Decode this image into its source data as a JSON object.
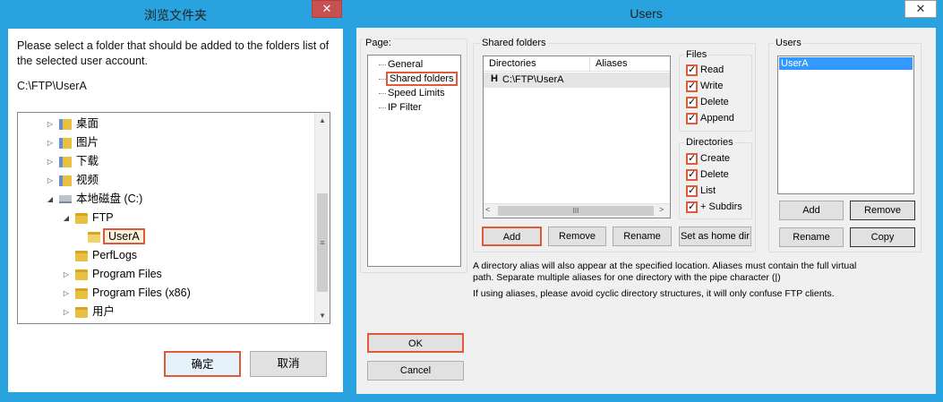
{
  "browse": {
    "title": "浏览文件夹",
    "close": "✕",
    "description": "Please select a folder that should be added to the folders list of the selected user account.",
    "path": "C:\\FTP\\UserA",
    "tree": [
      {
        "label": "桌面",
        "expander": "▷"
      },
      {
        "label": "图片",
        "expander": "▷"
      },
      {
        "label": "下载",
        "expander": "▷"
      },
      {
        "label": "视频",
        "expander": "▷"
      },
      {
        "label": "本地磁盘 (C:)",
        "expander": "◢"
      },
      {
        "label": "FTP",
        "expander": "◢"
      },
      {
        "label": "UserA",
        "expander": ""
      },
      {
        "label": "PerfLogs",
        "expander": ""
      },
      {
        "label": "Program Files",
        "expander": "▷"
      },
      {
        "label": "Program Files (x86)",
        "expander": "▷"
      },
      {
        "label": "用户",
        "expander": "▷"
      }
    ],
    "ok": "确定",
    "cancel": "取消"
  },
  "users": {
    "title": "Users",
    "close": "✕",
    "page_label": "Page:",
    "pages": [
      "General",
      "Shared folders",
      "Speed Limits",
      "IP Filter"
    ],
    "shared_folders_label": "Shared folders",
    "columns": [
      "Directories",
      "Aliases"
    ],
    "directory_row": {
      "marker": "H",
      "path": "C:\\FTP\\UserA"
    },
    "hscroll_thumb": "III",
    "files_label": "Files",
    "files_perms": [
      "Read",
      "Write",
      "Delete",
      "Append"
    ],
    "directories_label": "Directories",
    "dir_perms": [
      "Create",
      "Delete",
      "List",
      "+ Subdirs"
    ],
    "buttons": {
      "add": "Add",
      "remove": "Remove",
      "rename": "Rename",
      "set_home": "Set as home dir"
    },
    "users_label": "Users",
    "user_list": [
      "UserA"
    ],
    "user_buttons": {
      "add": "Add",
      "remove": "Remove",
      "rename": "Rename",
      "copy": "Copy"
    },
    "note1": "A directory alias will also appear at the specified location. Aliases must contain the full virtual path. Separate multiple aliases for one directory with the pipe character (|)",
    "note2": "If using aliases, please avoid cyclic directory structures, it will only confuse FTP clients.",
    "ok": "OK",
    "cancel": "Cancel"
  },
  "colors": {
    "titlebar": "#28a3df",
    "highlight": "#e05a3a",
    "selection": "#3399ff"
  }
}
